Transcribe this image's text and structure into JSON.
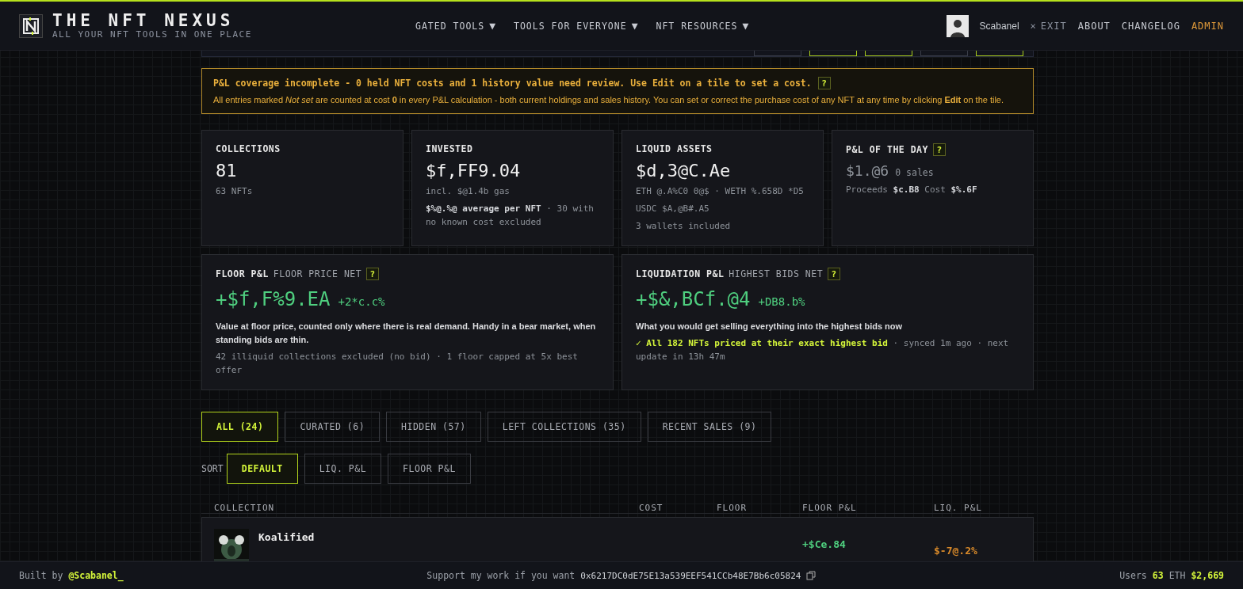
{
  "header": {
    "title": "THE NFT NEXUS",
    "subtitle": "ALL YOUR NFT TOOLS IN ONE PLACE",
    "nav": [
      {
        "label": "GATED TOOLS",
        "caret": "▼"
      },
      {
        "label": "TOOLS FOR EVERYONE",
        "caret": "▼"
      },
      {
        "label": "NFT RESOURCES",
        "caret": "▼"
      }
    ],
    "user": {
      "name": "Scabanel",
      "exit_icon": "×",
      "exit": "EXIT"
    },
    "links": [
      {
        "label": "ABOUT",
        "highlighted": false
      },
      {
        "label": "CHANGELOG",
        "highlighted": false
      },
      {
        "label": "ADMIN",
        "highlighted": true
      }
    ]
  },
  "toolbar": {
    "buttons": [
      {
        "selected": false
      },
      {
        "selected": true
      },
      {
        "selected": true
      },
      {
        "selected": false
      },
      {
        "selected": true
      }
    ]
  },
  "alert": {
    "title": "P&L coverage incomplete - 0 held NFT costs and 1 history value need review. Use Edit on a tile to set a cost.",
    "help": "?",
    "body": "All entries marked *Not set* are counted at cost **0** in every P&L calculation - both current holdings and sales history. You can set or correct the purchase cost of any NFT at any time by clicking **Edit** on the tile."
  },
  "stats": [
    {
      "label": "COLLECTIONS",
      "value": "81",
      "muted": false,
      "lines": [
        "63 NFTs"
      ]
    },
    {
      "label": "INVESTED",
      "value": "$f,FF9.04",
      "muted": false,
      "lines": [
        "incl. $@1.4b gas",
        "**$%@.%@ average per NFT** · 30 with no known cost excluded"
      ]
    },
    {
      "label": "LIQUID ASSETS",
      "value": "$d,3@C.Ae",
      "muted": false,
      "lines": [
        "ETH @.A%C0 0@$ · WETH %.658D *D5",
        "USDC $A,@B#.A5",
        "3 wallets included"
      ]
    },
    {
      "label": "P&L OF THE DAY",
      "help": "?",
      "value": "$1.@6",
      "value_note": "0 sales",
      "muted": true,
      "lines": [
        "Proceeds **$c.B8**  Cost **$%.6F**"
      ]
    }
  ],
  "pnl": [
    {
      "label": "FLOOR P&L",
      "sublabel": "FLOOR PRICE NET",
      "help": "?",
      "value": "+$f,F%9.EA",
      "change": "+2*c.c%",
      "description": "Value at floor price, counted only where there is real demand. Handy in a bear market, when standing bids are thin.",
      "note": "42 illiquid collections excluded (no bid) · 1 floor capped at 5x best offer"
    },
    {
      "label": "LIQUIDATION P&L",
      "sublabel": "HIGHEST BIDS NET",
      "help": "?",
      "value": "+$&,BCf.@4",
      "change": "+DB8.b%",
      "description": "What you would get selling everything into the highest bids now",
      "note": "**✓ All 182 NFTs priced at their exact highest bid** · synced 1m ago · next update in 13h 47m"
    }
  ],
  "tabs": [
    {
      "label": "ALL (24)",
      "selected": true
    },
    {
      "label": "CURATED (6)",
      "selected": false
    },
    {
      "label": "HIDDEN (57)",
      "selected": false
    },
    {
      "label": "LEFT COLLECTIONS (35)",
      "selected": false
    },
    {
      "label": "RECENT SALES (9)",
      "selected": false
    }
  ],
  "sort": {
    "label": "SORT",
    "options": [
      {
        "label": "DEFAULT",
        "selected": true
      },
      {
        "label": "LIQ. P&L",
        "selected": false
      },
      {
        "label": "FLOOR P&L",
        "selected": false
      }
    ]
  },
  "table": {
    "columns": [
      "COLLECTION",
      "COST",
      "FLOOR",
      "FLOOR P&L",
      "LIQ. P&L"
    ],
    "rows": [
      {
        "name": "Koalified",
        "floor_pnl": "+$Ce.84",
        "liq_pnl": "$-7@.2%"
      }
    ]
  },
  "footer": {
    "built_by": "Built by",
    "author": "@Scabanel_",
    "support": "Support my work if you want",
    "address": "0x6217DC0dE75E13a539EEF541CCb48E7Bb6c05824",
    "users_label": "Users",
    "users": "63",
    "eth_label": "ETH",
    "eth": "$2,669"
  }
}
